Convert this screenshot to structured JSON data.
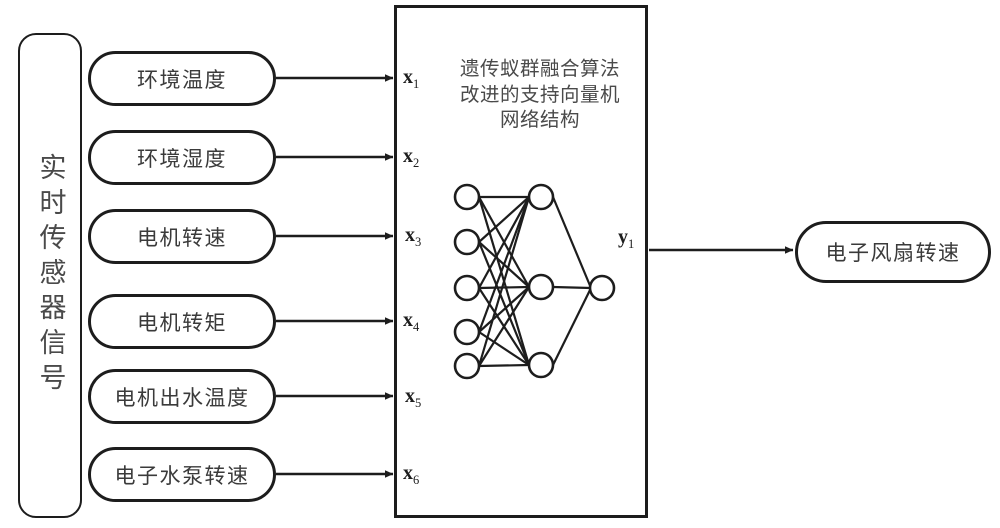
{
  "diagram": {
    "type": "block-flow-diagram",
    "background_color": "#ffffff",
    "stroke_color": "#1d1d1d",
    "text_color": "#3a3a3a"
  },
  "sensor_source": {
    "label": "实时传感器信号",
    "orientation": "vertical"
  },
  "inputs": [
    {
      "label": "环境温度",
      "variable": "x",
      "subscript": "1"
    },
    {
      "label": "环境湿度",
      "variable": "x",
      "subscript": "2"
    },
    {
      "label": "电机转速",
      "variable": "x",
      "subscript": "3"
    },
    {
      "label": "电机转矩",
      "variable": "x",
      "subscript": "4"
    },
    {
      "label": "电机出水温度",
      "variable": "x",
      "subscript": "5"
    },
    {
      "label": "电子水泵转速",
      "variable": "x",
      "subscript": "6"
    }
  ],
  "model": {
    "title": "遗传蚁群融合算法\n改进的支持向量机\n网络结构",
    "title_lines": [
      "遗传蚁群融合算法",
      "改进的支持向量机",
      "网络结构"
    ],
    "network": {
      "input_layer_nodes": 5,
      "hidden_layer_nodes": 3,
      "output_layer_nodes": 1,
      "fully_connected": true
    }
  },
  "output": {
    "variable": "y",
    "subscript": "1",
    "label": "电子风扇转速"
  }
}
